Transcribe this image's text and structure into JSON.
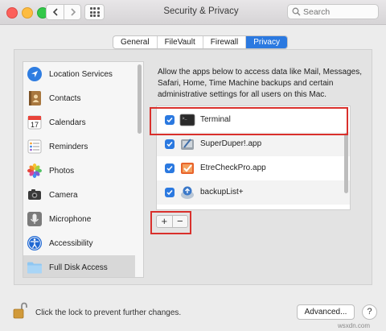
{
  "window": {
    "title": "Security & Privacy",
    "search_placeholder": "Search"
  },
  "tabs": [
    {
      "label": "General",
      "active": false
    },
    {
      "label": "FileVault",
      "active": false
    },
    {
      "label": "Firewall",
      "active": false
    },
    {
      "label": "Privacy",
      "active": true
    }
  ],
  "sidebar": {
    "items": [
      {
        "label": "Location Services",
        "icon": "location-arrow-icon"
      },
      {
        "label": "Contacts",
        "icon": "contacts-book-icon"
      },
      {
        "label": "Calendars",
        "icon": "calendar-icon"
      },
      {
        "label": "Reminders",
        "icon": "reminders-list-icon"
      },
      {
        "label": "Photos",
        "icon": "photos-flower-icon"
      },
      {
        "label": "Camera",
        "icon": "camera-icon"
      },
      {
        "label": "Microphone",
        "icon": "microphone-icon"
      },
      {
        "label": "Accessibility",
        "icon": "accessibility-icon"
      },
      {
        "label": "Full Disk Access",
        "icon": "folder-icon",
        "selected": true
      }
    ],
    "calendar_day": "17"
  },
  "main": {
    "description": "Allow the apps below to access data like Mail, Messages, Safari, Home, Time Machine backups and certain administrative settings for all users on this Mac.",
    "apps": [
      {
        "name": "Terminal",
        "checked": true,
        "icon": "terminal-icon"
      },
      {
        "name": "SuperDuper!.app",
        "checked": true,
        "icon": "superduper-icon"
      },
      {
        "name": "EtreCheckPro.app",
        "checked": true,
        "icon": "etrecheck-icon"
      },
      {
        "name": "backupList+",
        "checked": true,
        "icon": "backuplist-icon"
      }
    ],
    "add_label": "+",
    "remove_label": "−"
  },
  "footer": {
    "lock_text": "Click the lock to prevent further changes.",
    "advanced_label": "Advanced...",
    "help_label": "?"
  },
  "watermark": "wsxdn.com",
  "colors": {
    "accent": "#2b79e0",
    "highlight_box": "#d9302c"
  }
}
